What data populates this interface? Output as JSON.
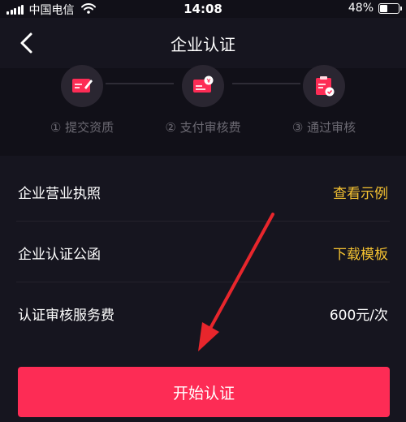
{
  "status_bar": {
    "carrier": "中国电信",
    "time": "14:08",
    "battery": "48%",
    "battery_level": 0.48
  },
  "header": {
    "title": "企业认证",
    "back_icon": "chevron-left-icon"
  },
  "steps": [
    {
      "label": "① 提交资质",
      "icon": "document-edit-icon"
    },
    {
      "label": "② 支付审核费",
      "icon": "payment-card-icon"
    },
    {
      "label": "③ 通过审核",
      "icon": "approved-certificate-icon"
    }
  ],
  "list": {
    "rows": [
      {
        "label": "企业营业执照",
        "value": "查看示例"
      },
      {
        "label": "企业认证公函",
        "value": "下载模板"
      },
      {
        "label": "认证审核服务费",
        "value": "600元/次"
      }
    ]
  },
  "actions": {
    "start_label": "开始认证"
  },
  "colors": {
    "background": "#16151f",
    "accent": "#fd2c55",
    "link": "#f5c231",
    "annotation": "#e8262c"
  }
}
